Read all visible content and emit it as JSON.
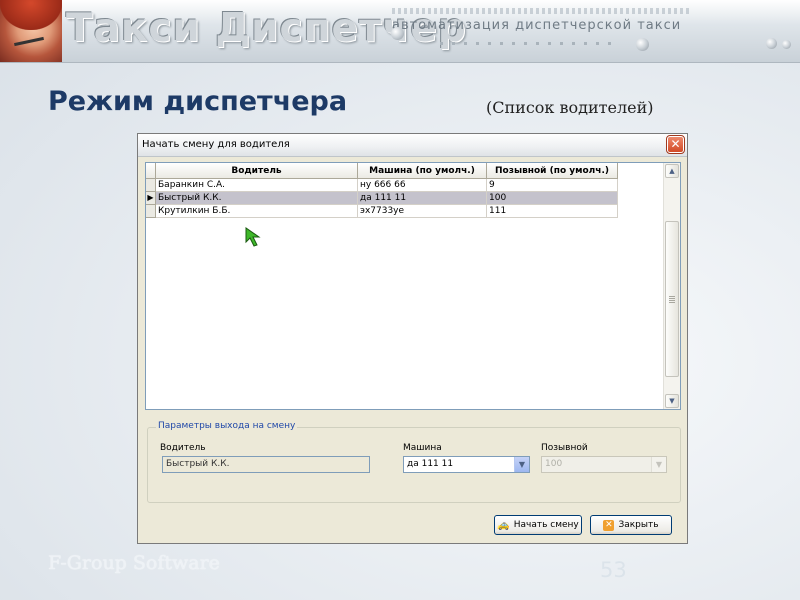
{
  "banner": {
    "brand": "Такси Диспетчер",
    "tagline": "автоматизация диспетчерской такси"
  },
  "slide": {
    "title": "Режим диспетчера",
    "subtitle": "(Список водителей)",
    "footer": "F-Group Software",
    "page_number": "53"
  },
  "window": {
    "title": "Начать смену для водителя",
    "close_glyph": "✕",
    "columns": [
      "Водитель",
      "Машина (по умолч.)",
      "Позывной (по умолч.)"
    ],
    "rows": [
      {
        "driver": "Баранкин С.А.",
        "car": "ну 666 66",
        "callsign": "9",
        "selected": false
      },
      {
        "driver": "Быстрый К.К.",
        "car": "да 111 11",
        "callsign": "100",
        "selected": true
      },
      {
        "driver": "Крутилкин Б.Б.",
        "car": "эх7733уе",
        "callsign": "111",
        "selected": false
      }
    ],
    "group": {
      "legend": "Параметры выхода на смену",
      "driver_label": "Водитель",
      "driver_value": "Быстрый К.К.",
      "car_label": "Машина",
      "car_value": "да 111 11",
      "callsign_label": "Позывной",
      "callsign_value": "100"
    },
    "buttons": {
      "start": "Начать смену",
      "close": "Закрыть"
    }
  },
  "colors": {
    "title": "#1d3a66",
    "selection": "#c4c2cc",
    "close_button": "#d24a26"
  }
}
